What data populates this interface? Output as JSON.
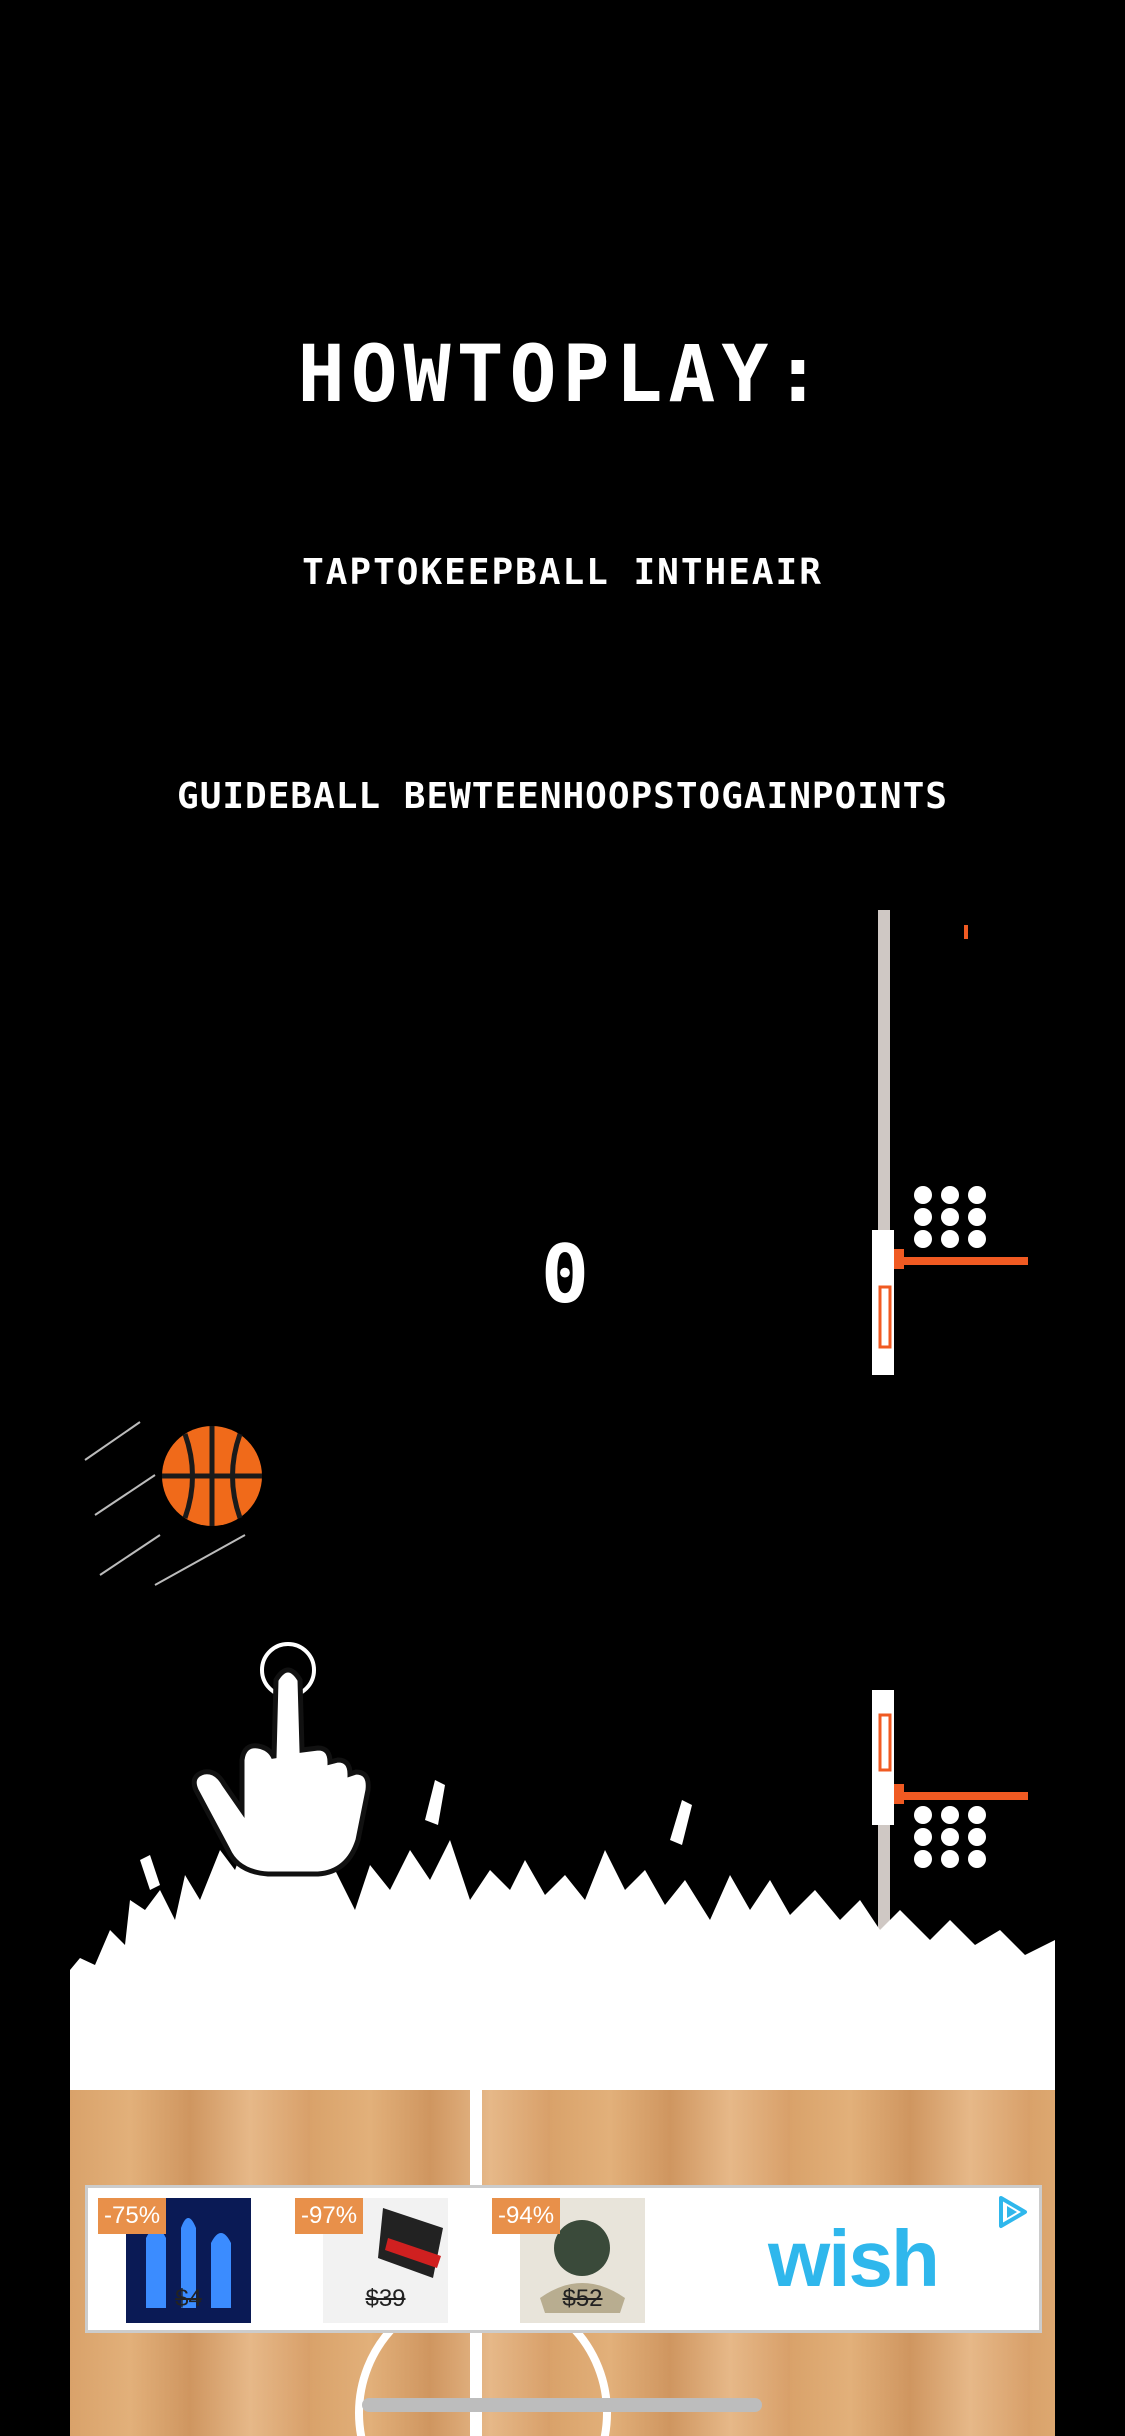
{
  "instructions": {
    "title": "HOWTOPLAY:",
    "line1": "TAPTOKEEPBALL INTHEAIR",
    "line2": "GUIDEBALL BEWTEENHOOPSTOGAINPOINTS"
  },
  "game": {
    "score": "0"
  },
  "ad": {
    "brand": "wish",
    "items": [
      {
        "discount": "-75%",
        "price": "$4"
      },
      {
        "discount": "-97%",
        "price": "$39"
      },
      {
        "discount": "-94%",
        "price": "$52"
      }
    ]
  },
  "colors": {
    "background": "#000000",
    "ball": "#f06a1a",
    "rim": "#f05a22",
    "pole": "#cfc8c4",
    "wish_blue": "#2fb7ec",
    "badge": "#e8904a"
  },
  "icons": [
    "basketball-icon",
    "tap-hand-icon",
    "hoop-icon",
    "adchoices-icon"
  ]
}
